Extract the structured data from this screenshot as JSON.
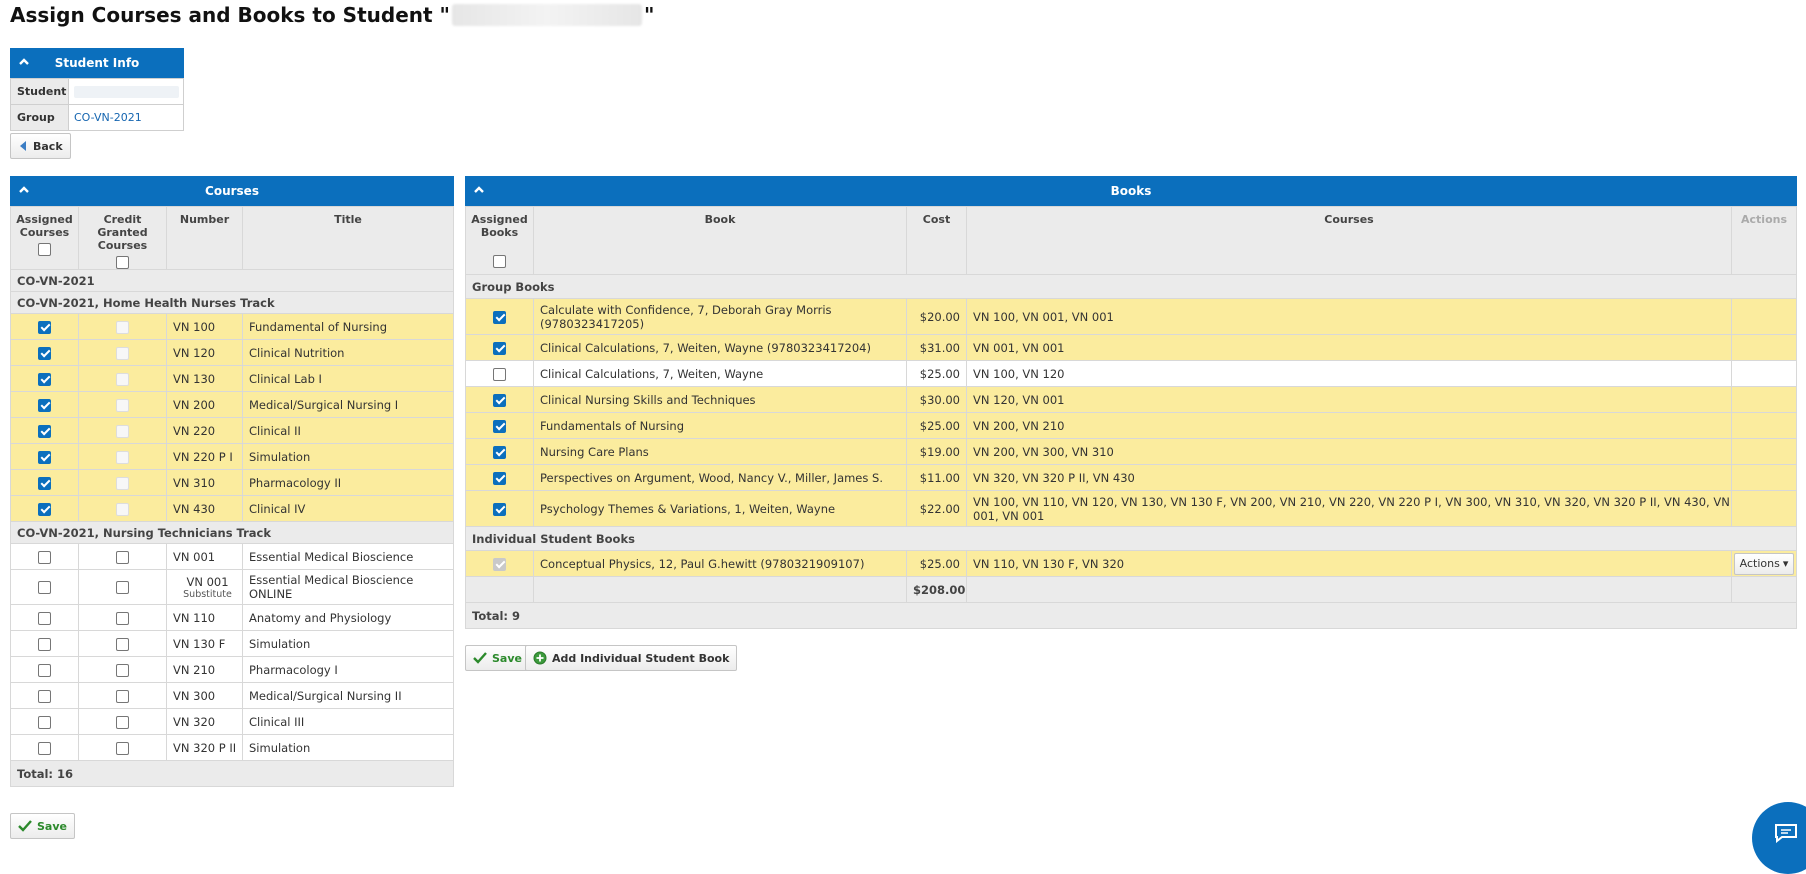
{
  "page": {
    "title_prefix": "Assign Courses and Books to Student \"",
    "title_suffix": "\""
  },
  "student_info": {
    "header": "Student Info",
    "student_label": "Student",
    "group_label": "Group",
    "group_value": "CO-VN-2021"
  },
  "back_label": "Back",
  "courses": {
    "header": "Courses",
    "columns": {
      "assigned": "Assigned Courses",
      "credit": "Credit Granted Courses",
      "number": "Number",
      "title": "Title"
    },
    "groups": [
      {
        "label": "CO-VN-2021",
        "rows": []
      },
      {
        "label": "CO-VN-2021, Home Health Nurses Track",
        "rows": [
          {
            "assigned": true,
            "credit": "disabled",
            "number": "VN 100",
            "title": "Fundamental of Nursing"
          },
          {
            "assigned": true,
            "credit": "disabled",
            "number": "VN 120",
            "title": "Clinical Nutrition"
          },
          {
            "assigned": true,
            "credit": "disabled",
            "number": "VN 130",
            "title": "Clinical Lab I"
          },
          {
            "assigned": true,
            "credit": "disabled",
            "number": "VN 200",
            "title": "Medical/Surgical Nursing I"
          },
          {
            "assigned": true,
            "credit": "disabled",
            "number": "VN 220",
            "title": "Clinical II"
          },
          {
            "assigned": true,
            "credit": "disabled",
            "number": "VN 220 P I",
            "title": "Simulation"
          },
          {
            "assigned": true,
            "credit": "disabled",
            "number": "VN 310",
            "title": "Pharmacology II"
          },
          {
            "assigned": true,
            "credit": "disabled",
            "number": "VN 430",
            "title": "Clinical IV"
          }
        ]
      },
      {
        "label": "CO-VN-2021, Nursing Technicians Track",
        "rows": [
          {
            "assigned": false,
            "credit": "off",
            "number": "VN 001",
            "title": "Essential Medical Bioscience"
          },
          {
            "assigned": false,
            "credit": "off",
            "number": "VN 001",
            "sub": "Substitute",
            "title": "Essential Medical Bioscience ONLINE"
          },
          {
            "assigned": false,
            "credit": "off",
            "number": "VN 110",
            "title": "Anatomy and Physiology"
          },
          {
            "assigned": false,
            "credit": "off",
            "number": "VN 130 F",
            "title": "Simulation"
          },
          {
            "assigned": false,
            "credit": "off",
            "number": "VN 210",
            "title": "Pharmacology I"
          },
          {
            "assigned": false,
            "credit": "off",
            "number": "VN 300",
            "title": "Medical/Surgical Nursing II"
          },
          {
            "assigned": false,
            "credit": "off",
            "number": "VN 320",
            "title": "Clinical III"
          },
          {
            "assigned": false,
            "credit": "off",
            "number": "VN 320 P II",
            "title": "Simulation"
          }
        ]
      }
    ],
    "total": "Total: 16",
    "save_label": "Save"
  },
  "books": {
    "header": "Books",
    "columns": {
      "assigned": "Assigned Books",
      "book": "Book",
      "cost": "Cost",
      "courses": "Courses",
      "actions": "Actions"
    },
    "groups": [
      {
        "label": "Group Books",
        "rows": [
          {
            "assigned": true,
            "book": "Calculate with Confidence, 7, Deborah Gray Morris (9780323417205)",
            "cost": "$20.00",
            "courses": "VN 100, VN 001, VN 001"
          },
          {
            "assigned": true,
            "book": "Clinical Calculations, 7, Weiten, Wayne (9780323417204)",
            "cost": "$31.00",
            "courses": "VN 001, VN 001"
          },
          {
            "assigned": false,
            "book": "Clinical Calculations, 7, Weiten, Wayne",
            "cost": "$25.00",
            "courses": "VN 100, VN 120"
          },
          {
            "assigned": true,
            "book": "Clinical Nursing Skills and Techniques",
            "cost": "$30.00",
            "courses": "VN 120, VN 001"
          },
          {
            "assigned": true,
            "book": "Fundamentals of Nursing",
            "cost": "$25.00",
            "courses": "VN 200, VN 210"
          },
          {
            "assigned": true,
            "book": "Nursing Care Plans",
            "cost": "$19.00",
            "courses": "VN 200, VN 300, VN 310"
          },
          {
            "assigned": true,
            "book": "Perspectives on Argument, Wood, Nancy V., Miller, James S.",
            "cost": "$11.00",
            "courses": "VN 320, VN 320 P II, VN 430"
          },
          {
            "assigned": true,
            "book": "Psychology Themes & Variations, 1, Weiten, Wayne",
            "cost": "$22.00",
            "courses": "VN 100, VN 110, VN 120, VN 130, VN 130 F, VN 200, VN 210, VN 220, VN 220 P I, VN 300, VN 310, VN 320, VN 320 P II, VN 430, VN 001, VN 001"
          }
        ]
      },
      {
        "label": "Individual Student Books",
        "rows": [
          {
            "assigned": "disabled-on",
            "book": "Conceptual Physics, 12, Paul G.hewitt (9780321909107)",
            "cost": "$25.00",
            "courses": "VN 110, VN 130 F, VN 320",
            "action": "Actions"
          }
        ]
      }
    ],
    "sum": "$208.00",
    "total": "Total: 9",
    "save_label": "Save",
    "add_label": "Add Individual Student Book"
  },
  "colors": {
    "header_blue": "#0b6fbd",
    "row_yellow": "#fbec9e",
    "save_green": "#2c8a2c"
  }
}
